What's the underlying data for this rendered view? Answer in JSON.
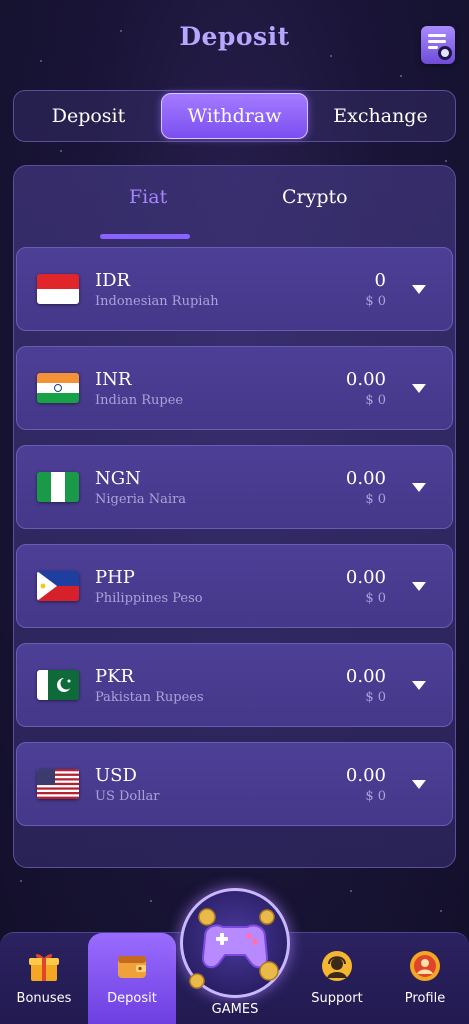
{
  "header": {
    "title": "Deposit",
    "history_icon": "document-search-icon"
  },
  "tabs": [
    {
      "label": "Deposit",
      "active": false
    },
    {
      "label": "Withdraw",
      "active": true
    },
    {
      "label": "Exchange",
      "active": false
    }
  ],
  "subtabs": {
    "fiat": "Fiat",
    "crypto": "Crypto",
    "active": "fiat"
  },
  "currencies": [
    {
      "code": "IDR",
      "name": "Indonesian Rupiah",
      "amount": "0",
      "usd": "$ 0",
      "flag_icon": "indonesia-flag-icon"
    },
    {
      "code": "INR",
      "name": "Indian Rupee",
      "amount": "0.00",
      "usd": "$ 0",
      "flag_icon": "india-flag-icon"
    },
    {
      "code": "NGN",
      "name": "Nigeria Naira",
      "amount": "0.00",
      "usd": "$ 0",
      "flag_icon": "nigeria-flag-icon"
    },
    {
      "code": "PHP",
      "name": "Philippines Peso",
      "amount": "0.00",
      "usd": "$ 0",
      "flag_icon": "philippines-flag-icon"
    },
    {
      "code": "PKR",
      "name": "Pakistan Rupees",
      "amount": "0.00",
      "usd": "$ 0",
      "flag_icon": "pakistan-flag-icon"
    },
    {
      "code": "USD",
      "name": "US Dollar",
      "amount": "0.00",
      "usd": "$ 0",
      "flag_icon": "usa-flag-icon"
    }
  ],
  "bottom_nav": {
    "bonuses": "Bonuses",
    "deposit": "Deposit",
    "games": "GAMES",
    "support": "Support",
    "profile": "Profile",
    "active": "deposit"
  },
  "colors": {
    "accent": "#8a62ff",
    "title": "#b9a6ff",
    "background": "#1a1538"
  }
}
